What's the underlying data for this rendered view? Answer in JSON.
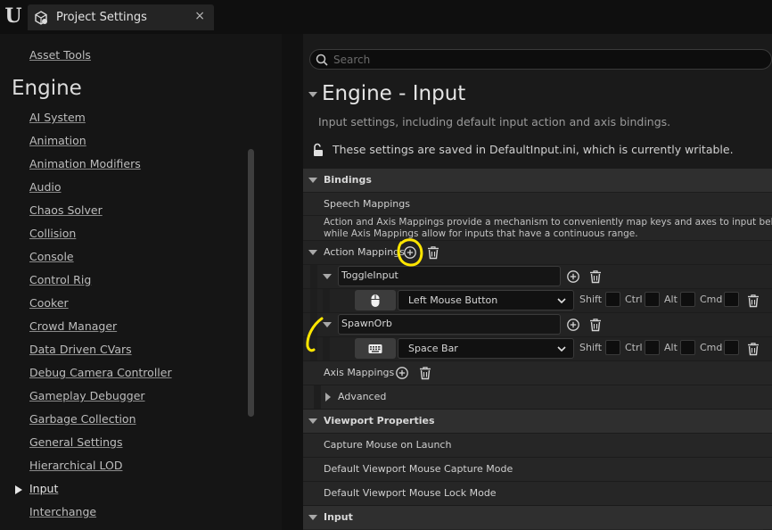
{
  "window": {
    "tab_title": "Project Settings",
    "close_glyph": "×",
    "logo_glyph": "U"
  },
  "sidebar": {
    "top_item": "Asset Tools",
    "heading": "Engine",
    "items": [
      "AI System",
      "Animation",
      "Animation Modifiers",
      "Audio",
      "Chaos Solver",
      "Collision",
      "Console",
      "Control Rig",
      "Cooker",
      "Crowd Manager",
      "Data Driven CVars",
      "Debug Camera Controller",
      "Gameplay Debugger",
      "Garbage Collection",
      "General Settings",
      "Hierarchical LOD",
      "Input",
      "Interchange"
    ],
    "active_item": "Input"
  },
  "search": {
    "placeholder": "Search"
  },
  "section": {
    "title": "Engine - Input",
    "description": "Input settings, including default input action and axis bindings.",
    "save_note": "These settings are saved in DefaultInput.ini, which is currently writable."
  },
  "bindings": {
    "category": "Bindings",
    "speech_mappings": "Speech Mappings",
    "desc_line1": "Action and Axis Mappings provide a mechanism to conveniently map keys and axes to input behavio",
    "desc_line2": "while Axis Mappings allow for inputs that have a continuous range.",
    "action_mappings": "Action Mappings",
    "actions": [
      {
        "name": "ToggleInput",
        "key": "Left Mouse Button",
        "device_icon": "mouse-icon"
      },
      {
        "name": "SpawnOrb",
        "key": "Space Bar",
        "device_icon": "keyboard-icon"
      }
    ],
    "modifiers": [
      "Shift",
      "Ctrl",
      "Alt",
      "Cmd"
    ],
    "axis_mappings": "Axis Mappings",
    "advanced": "Advanced"
  },
  "viewport": {
    "category": "Viewport Properties",
    "items": [
      "Capture Mouse on Launch",
      "Default Viewport Mouse Capture Mode",
      "Default Viewport Mouse Lock Mode"
    ]
  },
  "input_category": "Input",
  "colors": {
    "annotation": "#ffe600",
    "background": "#151515",
    "panel": "#242424",
    "category": "#2f2f2f"
  }
}
